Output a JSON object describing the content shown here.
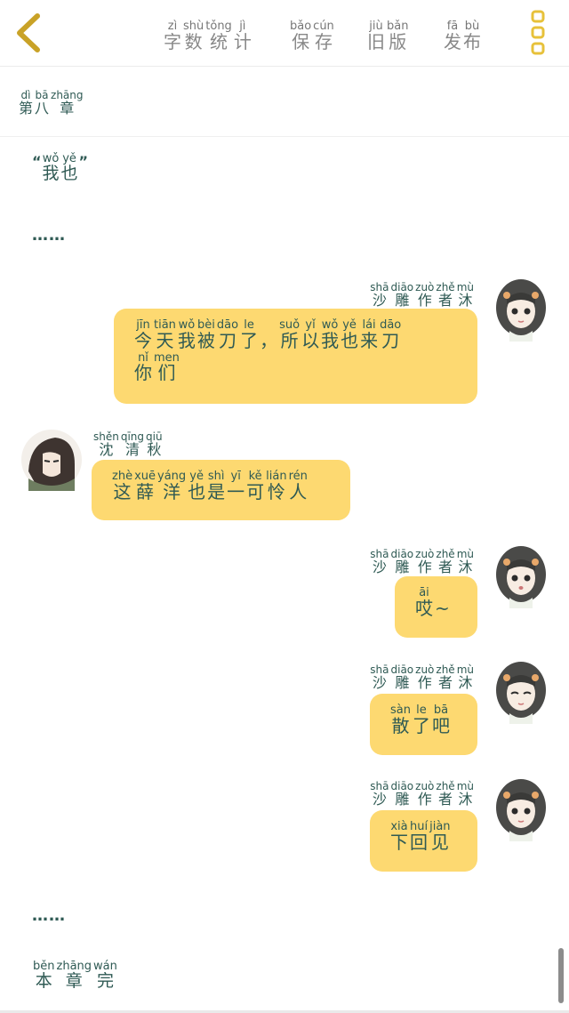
{
  "toolbar": {
    "word_count": [
      [
        "zì",
        "字"
      ],
      [
        "shù",
        "数"
      ],
      [
        "tǒng",
        "统"
      ],
      [
        "jì",
        "计"
      ]
    ],
    "save": [
      [
        "bǎo",
        "保"
      ],
      [
        "cún",
        "存"
      ]
    ],
    "old_version": [
      [
        "jiù",
        "旧"
      ],
      [
        "bǎn",
        "版"
      ]
    ],
    "publish": [
      [
        "fā",
        "发"
      ],
      [
        "bù",
        "布"
      ]
    ]
  },
  "chapter_title": [
    [
      "dì",
      "第"
    ],
    [
      "bā",
      "八"
    ],
    [
      "zhāng",
      "章"
    ]
  ],
  "narration_1": {
    "open_quote": "“",
    "close_quote": "”",
    "text": [
      [
        "wǒ",
        "我"
      ],
      [
        "yě",
        "也"
      ]
    ]
  },
  "ellipsis_1": "……",
  "speakers": {
    "author": [
      [
        "shā",
        "沙"
      ],
      [
        "diāo",
        "雕"
      ],
      [
        "zuò",
        "作"
      ],
      [
        "zhě",
        "者"
      ],
      [
        "mù",
        "沐"
      ]
    ],
    "shen_qingqiu": [
      [
        "shěn",
        "沈"
      ],
      [
        "qīng",
        "清"
      ],
      [
        "qiū",
        "秋"
      ]
    ]
  },
  "messages": [
    {
      "lines": [
        [
          [
            "jīn",
            "今"
          ],
          [
            "tiān",
            "天"
          ],
          [
            "wǒ",
            "我"
          ],
          [
            "bèi",
            "被"
          ],
          [
            "dāo",
            "刀"
          ],
          [
            "le",
            "了"
          ],
          [
            "",
            "，"
          ],
          [
            "suǒ",
            "所"
          ],
          [
            "yǐ",
            "以"
          ],
          [
            "wǒ",
            "我"
          ],
          [
            "yě",
            "也"
          ],
          [
            "lái",
            "来"
          ],
          [
            "dāo",
            "刀"
          ]
        ],
        [
          [
            "nǐ",
            "你"
          ],
          [
            "men",
            "们"
          ]
        ]
      ]
    },
    {
      "lines": [
        [
          [
            "zhè",
            "这"
          ],
          [
            "xuē",
            "薛"
          ],
          [
            "yáng",
            "洋"
          ],
          [
            "yě",
            "也"
          ],
          [
            "shì",
            "是"
          ],
          [
            "yī",
            "一"
          ],
          [
            "kě",
            "可"
          ],
          [
            "lián",
            "怜"
          ],
          [
            "rén",
            "人"
          ]
        ]
      ]
    },
    {
      "lines": [
        [
          [
            "āi",
            "哎"
          ],
          [
            "",
            "~"
          ]
        ]
      ]
    },
    {
      "lines": [
        [
          [
            "sàn",
            "散"
          ],
          [
            "le",
            "了"
          ],
          [
            "bā",
            "吧"
          ]
        ]
      ]
    },
    {
      "lines": [
        [
          [
            "xià",
            "下"
          ],
          [
            "huí",
            "回"
          ],
          [
            "jiàn",
            "见"
          ]
        ]
      ]
    }
  ],
  "ellipsis_2": "……",
  "chapter_end": [
    [
      "běn",
      "本"
    ],
    [
      "zhāng",
      "章"
    ],
    [
      "wán",
      "完"
    ]
  ],
  "colors": {
    "bubble": "#fdd971",
    "text": "#2f5a54",
    "back_icon": "#c9a227",
    "menu_icon": "#e7c13a"
  }
}
